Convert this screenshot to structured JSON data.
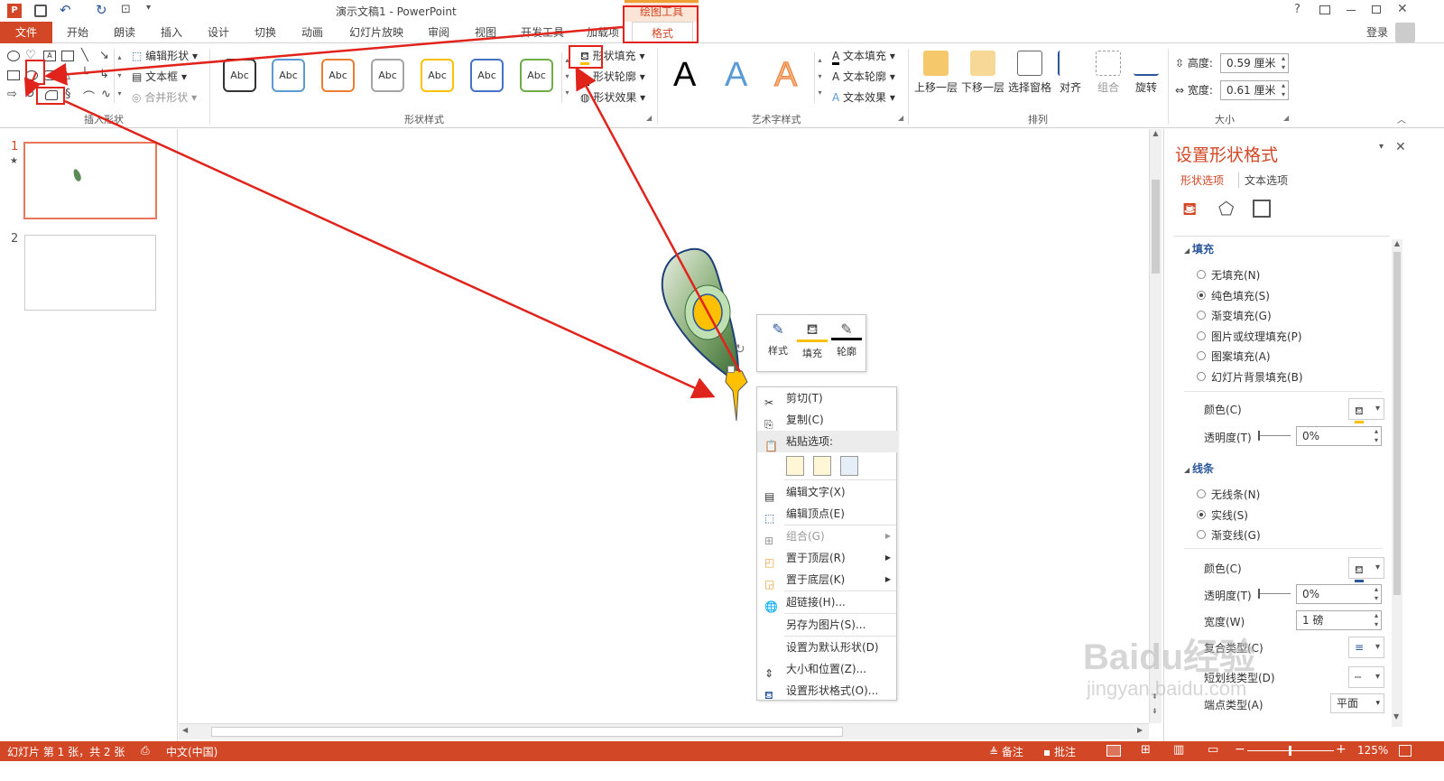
{
  "window": {
    "title": "演示文稿1 - PowerPoint",
    "help": "?",
    "login": "登录"
  },
  "context_tab": {
    "group": "绘图工具",
    "tab": "格式"
  },
  "tabs": [
    "文件",
    "开始",
    "朗读",
    "插入",
    "设计",
    "切换",
    "动画",
    "幻灯片放映",
    "审阅",
    "视图",
    "开发工具",
    "加载项"
  ],
  "ribbon": {
    "insert_shapes": {
      "label": "插入形状",
      "edit_shape": "编辑形状",
      "textbox": "文本框",
      "merge": "合并形状"
    },
    "shape_styles": {
      "label": "形状样式",
      "abc": "Abc",
      "fill": "形状填充",
      "outline": "形状轮廓",
      "effect": "形状效果",
      "colors": [
        "#333333",
        "#5b9bd5",
        "#ed7d31",
        "#a5a5a5",
        "#ffc000",
        "#4472c4",
        "#70ad47"
      ]
    },
    "wordart": {
      "label": "艺术字样式",
      "letter": "A",
      "fill": "文本填充",
      "outline": "文本轮廓",
      "effect": "文本效果"
    },
    "arrange": {
      "label": "排列",
      "bring_forward": "上移一层",
      "send_backward": "下移一层",
      "selection_pane": "选择窗格",
      "align": "对齐",
      "group": "组合",
      "rotate": "旋转"
    },
    "size": {
      "label": "大小",
      "height_label": "高度:",
      "height": "0.59 厘米",
      "width_label": "宽度:",
      "width": "0.61 厘米"
    }
  },
  "slides": [
    {
      "num": "1",
      "star": "★"
    },
    {
      "num": "2"
    }
  ],
  "mini_toolbar": {
    "style": "样式",
    "fill": "填充",
    "outline": "轮廓"
  },
  "context_menu": [
    "剪切(T)",
    "复制(C)",
    "粘贴选项:",
    "编辑文字(X)",
    "编辑顶点(E)",
    "组合(G)",
    "置于顶层(R)",
    "置于底层(K)",
    "超链接(H)...",
    "另存为图片(S)...",
    "设置为默认形状(D)",
    "大小和位置(Z)...",
    "设置形状格式(O)..."
  ],
  "format_pane": {
    "title": "设置形状格式",
    "tab_shape": "形状选项",
    "tab_text": "文本选项",
    "fill_header": "填充",
    "fill_options": [
      "无填充(N)",
      "纯色填充(S)",
      "渐变填充(G)",
      "图片或纹理填充(P)",
      "图案填充(A)",
      "幻灯片背景填充(B)"
    ],
    "color_label": "颜色(C)",
    "transparency_label": "透明度(T)",
    "transparency": "0%",
    "line_header": "线条",
    "line_options": [
      "无线条(N)",
      "实线(S)",
      "渐变线(G)"
    ],
    "line_color_label": "颜色(C)",
    "line_transparency_label": "透明度(T)",
    "line_transparency": "0%",
    "width_label": "宽度(W)",
    "width": "1 磅",
    "compound_label": "复合类型(C)",
    "dash_label": "短划线类型(D)",
    "cap_label": "端点类型(A)",
    "cap": "平面"
  },
  "status": {
    "slide": "幻灯片 第 1 张，共 2 张",
    "lang": "中文(中国)",
    "notes": "备注",
    "comments": "批注",
    "zoom": "125%"
  },
  "watermark": {
    "brand": "Baidu经验",
    "url": "jingyan.baidu.com"
  }
}
